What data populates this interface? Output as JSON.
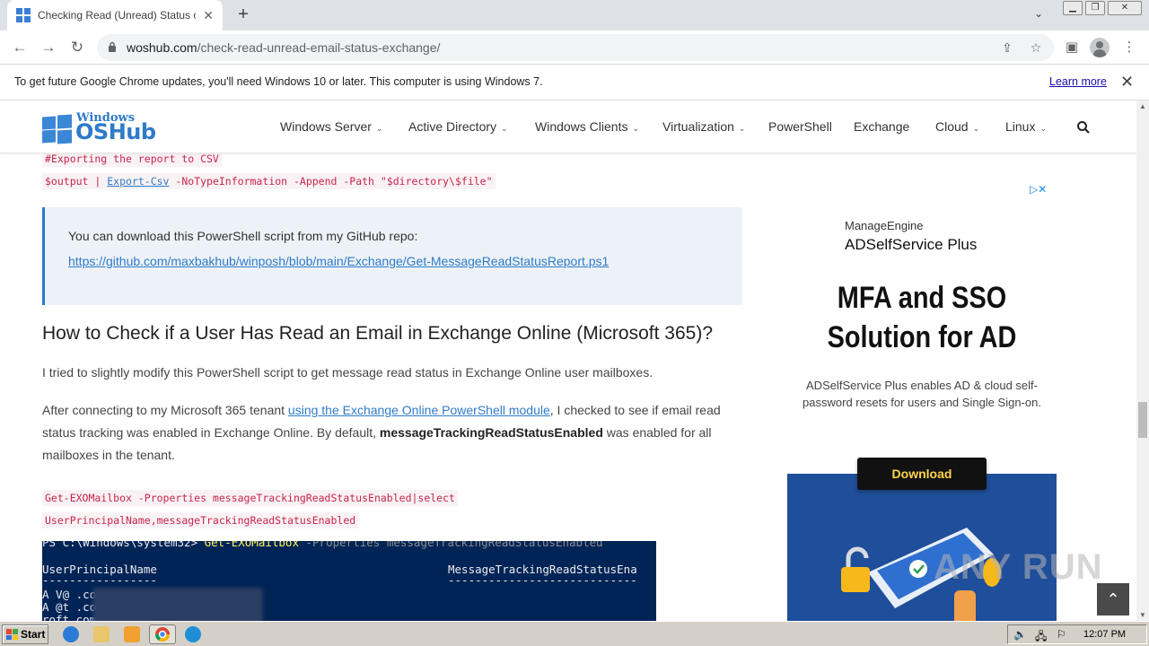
{
  "browser": {
    "tab_title": "Checking Read (Unread) Status of E",
    "url_domain": "woshub.com",
    "url_path": "/check-read-unread-email-status-exchange/"
  },
  "infobar": {
    "message": "To get future Google Chrome updates, you'll need Windows 10 or later. This computer is using Windows 7.",
    "learn_more": "Learn more"
  },
  "site": {
    "logo_top": "Windows",
    "logo_bottom": "OSHub",
    "menu": [
      {
        "label": "Windows Server",
        "has_dropdown": true
      },
      {
        "label": "Active Directory",
        "has_dropdown": true
      },
      {
        "label": "Windows Clients",
        "has_dropdown": true
      },
      {
        "label": "Virtualization",
        "has_dropdown": true
      },
      {
        "label": "PowerShell",
        "has_dropdown": false
      },
      {
        "label": "Exchange",
        "has_dropdown": false
      },
      {
        "label": "Cloud",
        "has_dropdown": true
      },
      {
        "label": "Linux",
        "has_dropdown": true
      }
    ]
  },
  "article": {
    "code1": "#Exporting the report to CSV",
    "code2_a": "$output | ",
    "code2_link": "Export-Csv",
    "code2_b": " -NoTypeInformation -Append -Path \"$directory\\$file\"",
    "note_text": "You can download this PowerShell script from my GitHub repo:",
    "note_link": "https://github.com/maxbakhub/winposh/blob/main/Exchange/Get-MessageReadStatusReport.ps1",
    "heading": "How to Check if a User Has Read an Email in Exchange Online (Microsoft 365)?",
    "para1": "I tried to slightly modify this PowerShell script to get message read status in Exchange Online user mailboxes.",
    "para2_a": "After connecting to my Microsoft 365 tenant ",
    "para2_link": "using the Exchange Online PowerShell module",
    "para2_b": ", I checked to see if email read status tracking was enabled in Exchange Online. By default, ",
    "para2_bold": "messageTrackingReadStatusEnabled",
    "para2_c": " was enabled for all mailboxes in the tenant.",
    "code3_line1": "Get-EXOMailbox -Properties messageTrackingReadStatusEnabled|select",
    "code3_line2": "UserPrincipalName,messageTrackingReadStatusEnabled",
    "ps_prompt": "PS C:\\Windows\\system32> ",
    "ps_cmd": "Get-EXOMailbox",
    "ps_rest": " -Properties messageTrackingReadStatusEnabled",
    "ps_col1": "UserPrincipalName",
    "ps_col2": "MessageTrackingReadStatusEna",
    "ps_sep1": "-----------------",
    "ps_sep2": "----------------------------",
    "ps_r1": "A         V@                      .com",
    "ps_r2": "A         @t                   .com",
    "ps_r3": "                        roft.com"
  },
  "ad": {
    "brand": "ManageEngine",
    "product": "ADSelfService Plus",
    "headline1": "MFA and SSO",
    "headline2": "Solution for AD",
    "desc1": "ADSelfService Plus enables AD & cloud self-",
    "desc2": "password resets for users and Single Sign-on.",
    "cta": "Download"
  },
  "watermark": "ANY RUN",
  "taskbar": {
    "start": "Start",
    "clock": "12:07 PM"
  },
  "colors": {
    "accent": "#2e7bc8",
    "code_red": "#c7254e",
    "ps_bg": "#012456"
  }
}
